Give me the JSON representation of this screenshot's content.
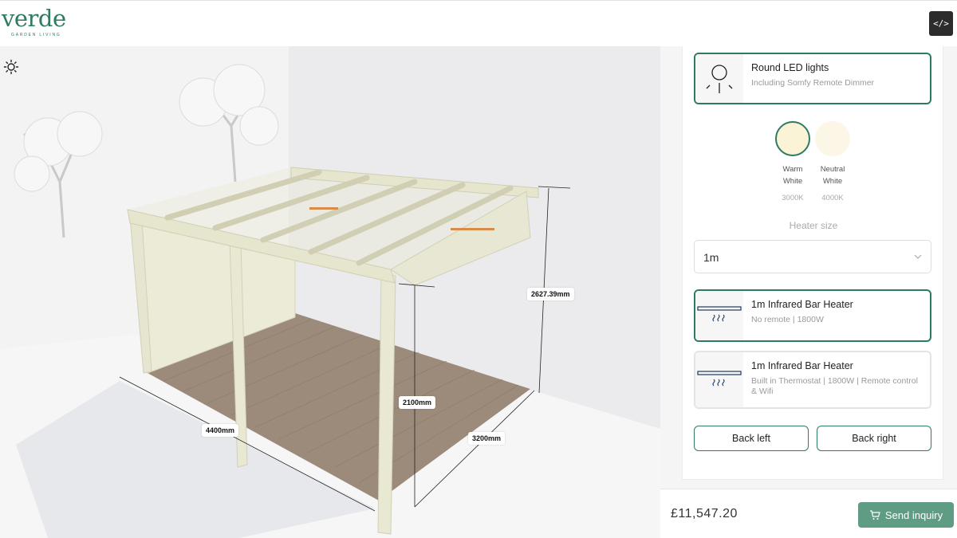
{
  "brand": {
    "name": "verde",
    "tagline": "GARDEN LIVING",
    "color": "#2e7a63"
  },
  "header": {
    "code_button_label": "</>"
  },
  "viewport": {
    "lighting_icon": "sun-icon",
    "dimensions": {
      "width": "4400mm",
      "depth": "3200mm",
      "height": "2100mm",
      "max_height": "2627.39mm"
    }
  },
  "lighting": {
    "option": {
      "title": "Round LED lights",
      "subtitle": "Including Somfy Remote Dimmer",
      "icon": "bulb-icon"
    },
    "colors": [
      {
        "name_line1": "Warm",
        "name_line2": "White",
        "kelvin": "3000K",
        "color": "#fbf3d6",
        "selected": true
      },
      {
        "name_line1": "Neutral",
        "name_line2": "White",
        "kelvin": "4000K",
        "color": "#fbf6e6",
        "selected": false
      }
    ]
  },
  "heater": {
    "label": "Heater size",
    "size_value": "1m",
    "options": [
      {
        "title": "1m Infrared Bar Heater",
        "subtitle": "No remote | 1800W",
        "selected": true
      },
      {
        "title": "1m Infrared Bar Heater",
        "subtitle": "Built in Thermostat | 1800W | Remote control & Wifi",
        "selected": false
      }
    ]
  },
  "actions": {
    "back_left": "Back left",
    "back_right": "Back right"
  },
  "footer": {
    "price": "£11,547.20",
    "send_label": "Send inquiry",
    "accent": "#5f9c84"
  }
}
